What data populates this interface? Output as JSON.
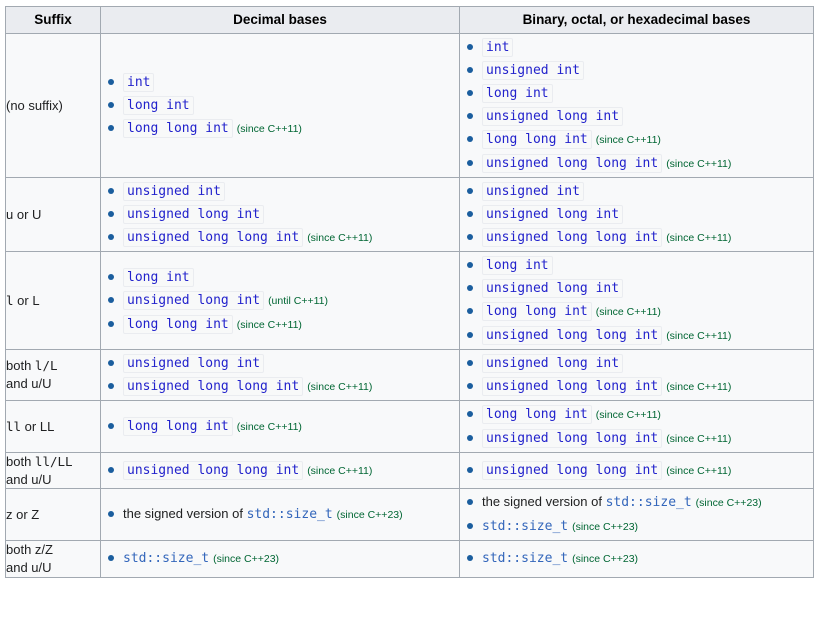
{
  "table": {
    "headers": {
      "suffix": "Suffix",
      "decimal": "Decimal bases",
      "binary": "Binary, octal, or hexadecimal bases"
    },
    "colors": {
      "code_text": "#2222cc",
      "link_text": "#3366bb",
      "since_note": "#006633",
      "bullet": "#1b5e9e",
      "header_bg": "#eaecf0",
      "cell_bg": "#f8f9fa",
      "border": "#a2a9b1"
    },
    "rows": [
      {
        "suffix_label": "(no suffix)",
        "suffix_mono_parts": [],
        "decimal": [
          {
            "kind": "code",
            "text": "int",
            "note": ""
          },
          {
            "kind": "code",
            "text": "long int",
            "note": ""
          },
          {
            "kind": "code",
            "text": "long long int",
            "note": "(since C++11)"
          }
        ],
        "binary": [
          {
            "kind": "code",
            "text": "int",
            "note": ""
          },
          {
            "kind": "code",
            "text": "unsigned int",
            "note": ""
          },
          {
            "kind": "code",
            "text": "long int",
            "note": ""
          },
          {
            "kind": "code",
            "text": "unsigned long int",
            "note": ""
          },
          {
            "kind": "code",
            "text": "long long int",
            "note": "(since C++11)"
          },
          {
            "kind": "code",
            "text": "unsigned long long int",
            "note": "(since C++11)"
          }
        ]
      },
      {
        "suffix_label": "u or U",
        "decimal": [
          {
            "kind": "code",
            "text": "unsigned int",
            "note": ""
          },
          {
            "kind": "code",
            "text": "unsigned long int",
            "note": ""
          },
          {
            "kind": "code",
            "text": "unsigned long long int",
            "note": "(since C++11)"
          }
        ],
        "binary": [
          {
            "kind": "code",
            "text": "unsigned int",
            "note": ""
          },
          {
            "kind": "code",
            "text": "unsigned long int",
            "note": ""
          },
          {
            "kind": "code",
            "text": "unsigned long long int",
            "note": "(since C++11)"
          }
        ]
      },
      {
        "suffix_label": "l or L",
        "decimal": [
          {
            "kind": "code",
            "text": "long int",
            "note": ""
          },
          {
            "kind": "code",
            "text": "unsigned long int",
            "note": "(until C++11)"
          },
          {
            "kind": "code",
            "text": "long long int",
            "note": "(since C++11)"
          }
        ],
        "binary": [
          {
            "kind": "code",
            "text": "long int",
            "note": ""
          },
          {
            "kind": "code",
            "text": "unsigned long int",
            "note": ""
          },
          {
            "kind": "code",
            "text": "long long int",
            "note": "(since C++11)"
          },
          {
            "kind": "code",
            "text": "unsigned long long int",
            "note": "(since C++11)"
          }
        ]
      },
      {
        "suffix_label": "both l/L\nand u/U",
        "decimal": [
          {
            "kind": "code",
            "text": "unsigned long int",
            "note": ""
          },
          {
            "kind": "code",
            "text": "unsigned long long int",
            "note": "(since C++11)"
          }
        ],
        "binary": [
          {
            "kind": "code",
            "text": "unsigned long int",
            "note": ""
          },
          {
            "kind": "code",
            "text": "unsigned long long int",
            "note": "(since C++11)"
          }
        ]
      },
      {
        "suffix_label": "ll or LL",
        "decimal": [
          {
            "kind": "code",
            "text": "long long int",
            "note": "(since C++11)"
          }
        ],
        "binary": [
          {
            "kind": "code",
            "text": "long long int",
            "note": "(since C++11)"
          },
          {
            "kind": "code",
            "text": "unsigned long long int",
            "note": "(since C++11)"
          }
        ]
      },
      {
        "suffix_label": "both ll/LL\nand u/U",
        "decimal": [
          {
            "kind": "code",
            "text": "unsigned long long int",
            "note": "(since C++11)"
          }
        ],
        "binary": [
          {
            "kind": "code",
            "text": "unsigned long long int",
            "note": "(since C++11)"
          }
        ]
      },
      {
        "suffix_label": "z or Z",
        "decimal": [
          {
            "kind": "text-link",
            "prefix": "the signed version of ",
            "text": "std::size_t",
            "note": "(since C++23)"
          }
        ],
        "binary": [
          {
            "kind": "text-link",
            "prefix": "the signed version of ",
            "text": "std::size_t",
            "note": "(since C++23)"
          },
          {
            "kind": "link",
            "text": "std::size_t",
            "note": "(since C++23)"
          }
        ]
      },
      {
        "suffix_label": "both z/Z\nand u/U",
        "decimal": [
          {
            "kind": "link",
            "text": "std::size_t",
            "note": "(since C++23)"
          }
        ],
        "binary": [
          {
            "kind": "link",
            "text": "std::size_t",
            "note": "(since C++23)"
          }
        ]
      }
    ]
  }
}
